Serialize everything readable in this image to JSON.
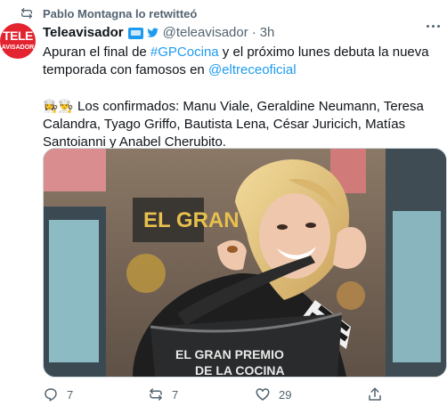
{
  "retweet": {
    "icon": "retweet-icon",
    "text": "Pablo Montagna lo retwitteó"
  },
  "author": {
    "avatar_line1": "TELE",
    "avatar_line2": "AVISADOR",
    "name": "Teleavisador",
    "tv_icon": "tv-icon",
    "bird_icon": "twitter-bird-icon",
    "handle": "@teleavisador",
    "separator": "·",
    "time": "3h"
  },
  "tweet": {
    "p1_a": "Apuran el final de ",
    "hashtag": "#GPCocina",
    "p1_b": " y el próximo lunes debuta la nueva temporada con famosos en ",
    "mention": "@eltreceoficial",
    "emoji": "👩‍🍳👨‍🍳",
    "p2": " Los confirmados: Manu Viale, Geraldine Neumann, Teresa Calandra, Tyago Griffo, Bautista Lena, César Juricich, Matías Santoianni y Anabel Cherubito."
  },
  "media": {
    "sign_text": "EL GRAN",
    "pot_line1": "EL GRAN PREMIO",
    "pot_line2": "DE LA COCINA"
  },
  "actions": {
    "reply_count": "7",
    "retweet_count": "7",
    "like_count": "29",
    "icons": [
      "reply-icon",
      "retweet-icon",
      "like-icon",
      "share-icon"
    ]
  },
  "colors": {
    "accent": "#1d9bf0",
    "secondary_text": "#536471",
    "avatar_red": "#e32330"
  }
}
